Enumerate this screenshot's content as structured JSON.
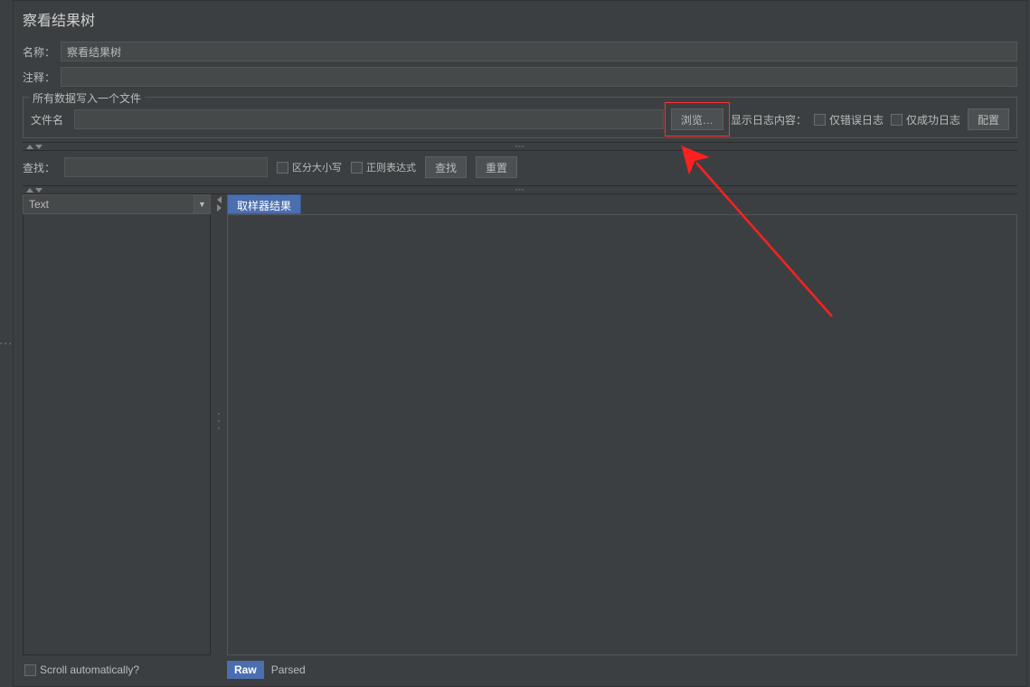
{
  "title": "察看结果树",
  "form": {
    "name_label": "名称：",
    "name_value": "察看结果树",
    "comment_label": "注释：",
    "comment_value": ""
  },
  "fileSection": {
    "legend": "所有数据写入一个文件",
    "filename_label": "文件名",
    "filename_value": "",
    "browse_btn": "浏览…",
    "log_content_label": "显示日志内容：",
    "error_only": "仅错误日志",
    "success_only": "仅成功日志",
    "config_btn": "配置"
  },
  "search": {
    "label": "查找：",
    "value": "",
    "case_sensitive": "区分大小写",
    "regex": "正则表达式",
    "find_btn": "查找",
    "reset_btn": "重置"
  },
  "dropdown": {
    "selected": "Text"
  },
  "tabs": {
    "sampler_result": "取样器结果"
  },
  "bottom": {
    "scroll_auto": "Scroll automatically?",
    "raw": "Raw",
    "parsed": "Parsed"
  }
}
